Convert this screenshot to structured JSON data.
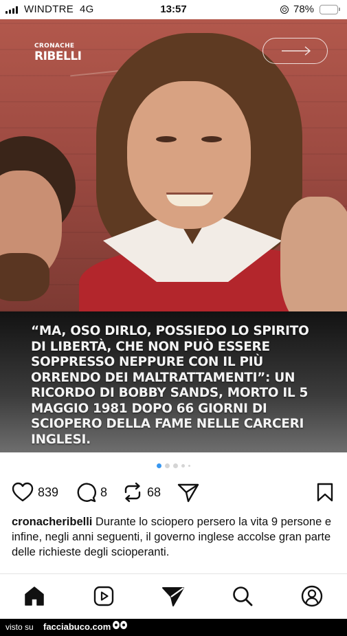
{
  "status_bar": {
    "carrier": "WINDTRE",
    "network": "4G",
    "time": "13:57",
    "battery_percent": "78%",
    "battery_level": 0.78,
    "battery_color": "#f2c21b"
  },
  "post": {
    "brand_logo": {
      "line1": "CRONACHE",
      "line2": "RIBELLI"
    },
    "next_icon": "arrow-right-icon",
    "quote": "“MA, OSO DIRLO, POSSIEDO LO SPIRITO DI LIBERTÀ, CHE NON PUÒ ESSERE SOPPRESSO NEPPURE CON IL PIÙ ORRENDO DEI MALTRATTAMENTI”: UN RICORDO DI BOBBY SANDS, MORTO IL 5 MAGGIO 1981 DOPO 66 GIORNI DI SCIOPERO DELLA FAME NELLE CARCERI INGLESI.",
    "carousel": {
      "count": 5,
      "active_index": 0,
      "active_color": "#3897f0"
    }
  },
  "actions": {
    "likes": "839",
    "comments": "8",
    "reposts": "68",
    "icons": [
      "heart-icon",
      "comment-icon",
      "repost-icon",
      "share-icon",
      "bookmark-icon"
    ]
  },
  "caption": {
    "username": "cronacheribelli",
    "text": "Durante lo sciopero persero la vita 9 persone e infine, negli anni seguenti, il governo inglese accolse gran parte delle richieste degli scioperanti."
  },
  "nav": {
    "items": [
      "home-icon",
      "reels-icon",
      "send-icon",
      "search-icon",
      "profile-icon"
    ]
  },
  "watermark": {
    "prefix": "visto su",
    "site": "facciabuco.com"
  }
}
